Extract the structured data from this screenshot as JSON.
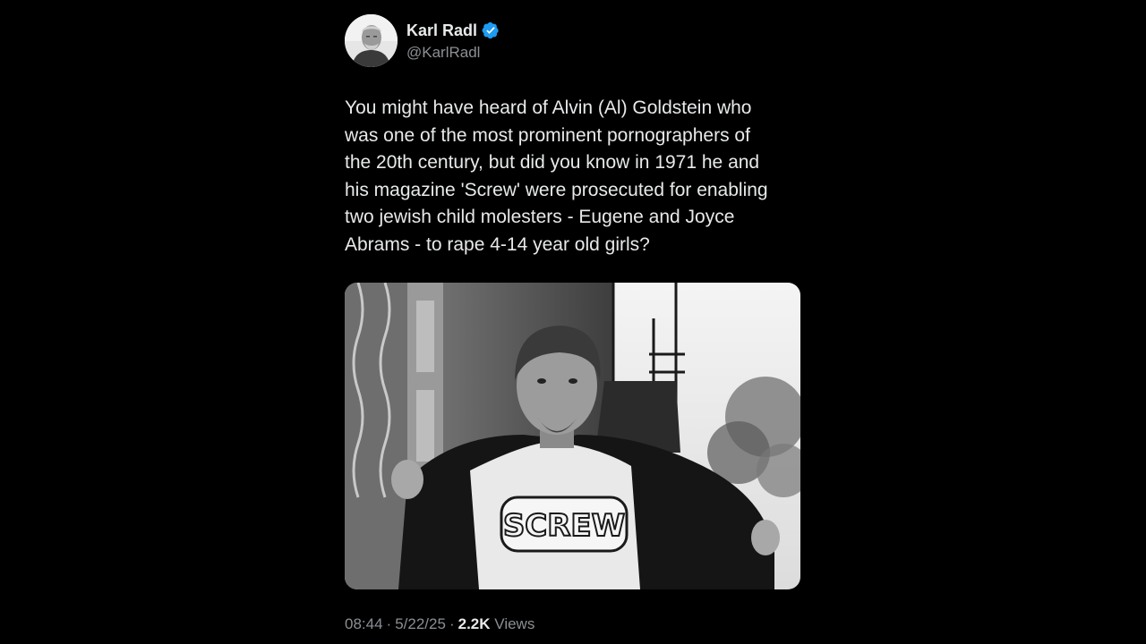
{
  "author": {
    "display_name": "Karl Radl",
    "handle": "@KarlRadl",
    "verified_icon": "verified-badge-icon",
    "badge_color": "#1d9bf0"
  },
  "post": {
    "text": "You might have heard of Alvin (Al) Goldstein who\nwas one of the most prominent pornographers of\nthe 20th century, but did you know in 1971 he and\nhis magazine 'Screw' were prosecuted for enabling\ntwo jewish child molesters - Eugene and Joyce\nAbrams - to rape 4-14 year old girls?",
    "image_shirt_text": "SCREW"
  },
  "meta": {
    "time": "08:44",
    "separator": "·",
    "date": "5/22/25",
    "views_count": "2.2K",
    "views_label": "Views"
  },
  "colors": {
    "background": "#000000",
    "primary_text": "#e7e9ea",
    "secondary_text": "#8b8f93"
  }
}
